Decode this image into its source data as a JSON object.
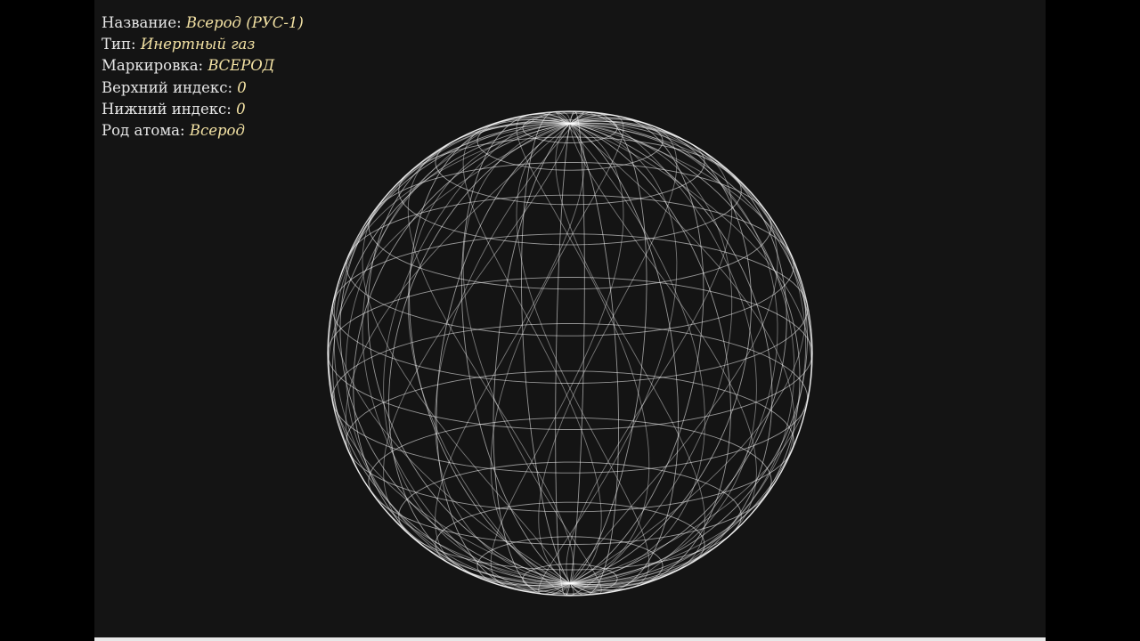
{
  "colors": {
    "background": "#141414",
    "label": "#e6e6e6",
    "value": "#f3e2a4",
    "wire": "#ffffff"
  },
  "info": {
    "rows": [
      {
        "label": "Название:",
        "value": "Всерод (РУС-1)"
      },
      {
        "label": "Тип:",
        "value": "Инертный газ"
      },
      {
        "label": "Маркировка:",
        "value": "ВСЕРОД"
      },
      {
        "label": "Верхний индекс:",
        "value": "0"
      },
      {
        "label": "Нижний индекс:",
        "value": "0"
      },
      {
        "label": "Род атома:",
        "value": "Всерод"
      }
    ]
  },
  "viewport": {
    "object": "wireframe-sphere-icon"
  }
}
